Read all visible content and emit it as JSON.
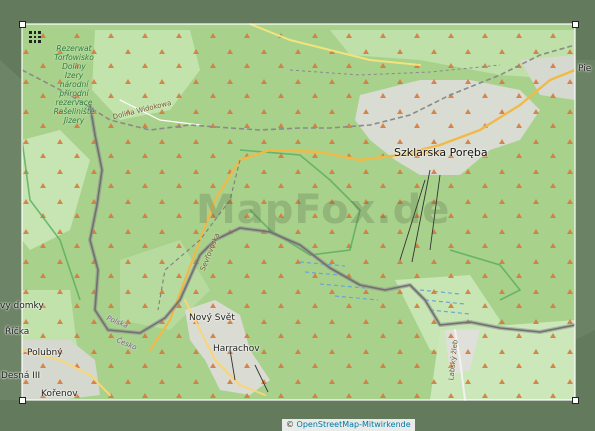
{
  "map": {
    "watermark": "MapFox.de",
    "places": {
      "szklarska": "Szklarska Poręba",
      "novy_svet": "Nový Svět",
      "harrachov": "Harrachov",
      "polubny": "Polubný",
      "korenov": "Kořenov",
      "desna": "Desná III",
      "ricka": "Říčka",
      "vy_domky": "vy domky",
      "pie": "Pie"
    },
    "reserve_label": [
      "Rezerwat",
      "Torfowisko",
      "Doliny",
      "Izery",
      "národní",
      "přírodní",
      "rezervace",
      "Rašeliniště",
      "Jizery"
    ],
    "roads": {
      "dolina_widokowa": "Dolina Widokowa",
      "seifenbach": "Sevřovoska",
      "czeska": "Česko",
      "polska": "Polska",
      "labska": "Labský žleb"
    },
    "attribution_prefix": "© ",
    "attribution_link": "OpenStreetMap-Mitwirkende"
  },
  "colors": {
    "forest": "#a9d28e",
    "meadow": "#cde8b8",
    "urban": "#dcdcdc",
    "border": "#8c7fa6",
    "road": "#f2c25a",
    "peak": "#d97a3c"
  }
}
